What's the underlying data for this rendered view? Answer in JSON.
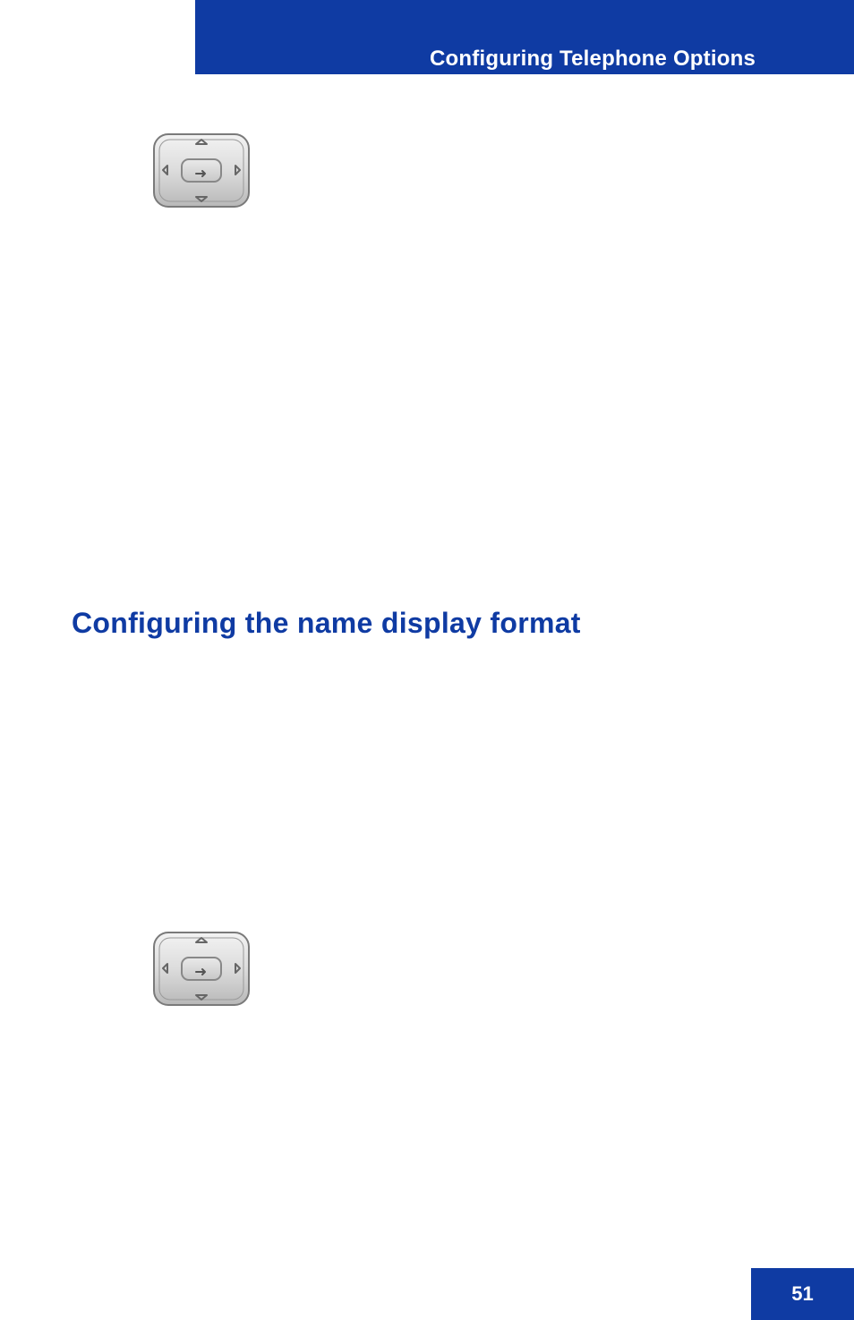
{
  "header": {
    "title": "Configuring Telephone Options"
  },
  "section": {
    "heading": "Configuring the name display format"
  },
  "footer": {
    "page_number": "51"
  }
}
